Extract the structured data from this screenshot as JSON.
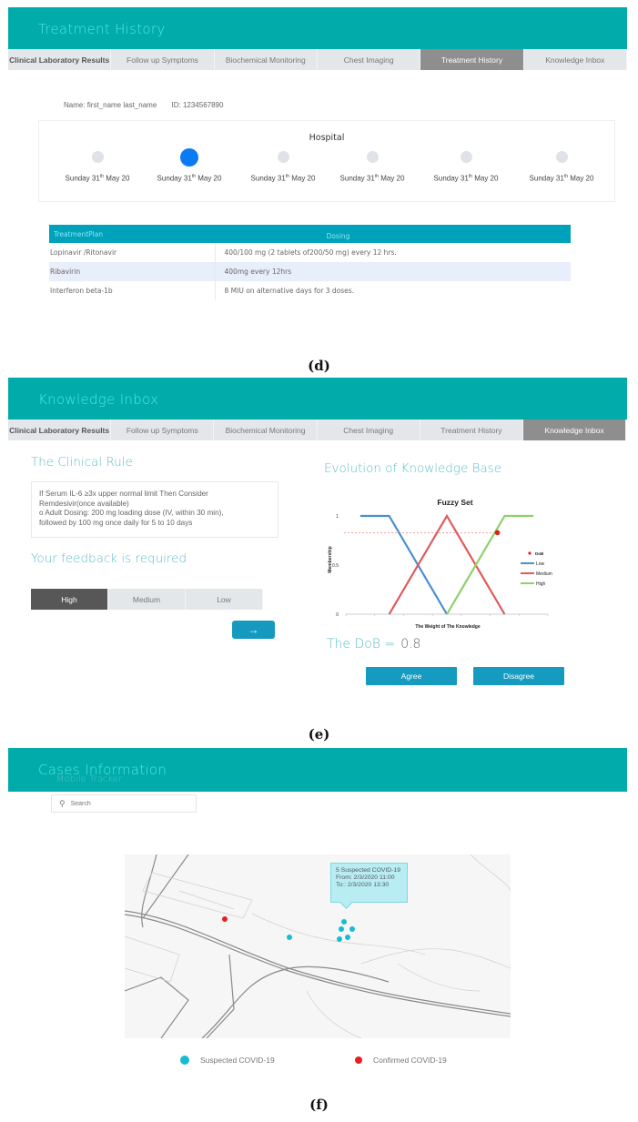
{
  "tabs": [
    "Clinical Laboratory Results",
    "Follow up Symptoms",
    "Biochemical Monitoring",
    "Chest Imaging",
    "Treatment History",
    "Knowledge Inbox"
  ],
  "panel_d": {
    "title": "Treatment History",
    "active_tab": 4,
    "patient": {
      "name": "Name: first_name last_name",
      "id": "ID: 1234567890"
    },
    "timeline": {
      "title": "Hospital",
      "selected_index": 1,
      "items": [
        {
          "day": "Sunday 31",
          "sup": "th",
          "rest": " May 20"
        },
        {
          "day": "Sunday 31",
          "sup": "th",
          "rest": " May 20"
        },
        {
          "day": "Sunday 31",
          "sup": "th",
          "rest": " May 20"
        },
        {
          "day": "Sunday 31",
          "sup": "th",
          "rest": " May 20"
        },
        {
          "day": "Sunday 31",
          "sup": "th",
          "rest": " May 20"
        },
        {
          "day": "Sunday 31",
          "sup": "th",
          "rest": " May 20"
        }
      ]
    },
    "table": {
      "headers": [
        "TreatmentPlan",
        "Dosing"
      ],
      "rows": [
        [
          "Lopinavir /Ritonavir",
          "400/100 mg (2 tablets of200/50 mg) every 12 hrs."
        ],
        [
          "Ribavirin",
          "400mg every 12hrs"
        ],
        [
          "Interferon beta-1b",
          "8 MIU on alternative days for 3 doses."
        ]
      ]
    },
    "caption": "(d)"
  },
  "panel_e": {
    "title": "Knowledge Inbox",
    "active_tab": 5,
    "rule_heading": "The Clinical Rule",
    "rule_lines": [
      "If Serum IL-6 ≥3x upper normal limit Then Consider",
      "Remdesivir(once available)",
      "o Adult Dosing: 200 mg loading dose (IV, within 30 min),",
      "followed by 100 mg once daily for 5 to 10 days"
    ],
    "feedback_heading": "Your feedback is required",
    "feedback_options": [
      "High",
      "Medium",
      "Low"
    ],
    "feedback_selected": 0,
    "next_icon": "→",
    "evolution_heading": "Evolution of Knowledge Base",
    "dob_label": "The DoB =",
    "dob_value": "0.8",
    "agree_label": "Agree",
    "disagree_label": "Disagree",
    "caption": "(e)"
  },
  "chart_data": {
    "type": "line",
    "title": "Fuzzy Set",
    "xlabel": "The Weight of The Knowledge",
    "ylabel": "Membership",
    "xlim": [
      0,
      7
    ],
    "ylim": [
      0,
      1
    ],
    "yticks": [
      "0",
      "0.5",
      "1"
    ],
    "xtick_count": 8,
    "grid": false,
    "legend_position": "right",
    "series": [
      {
        "name": "Low",
        "color": "#4a8fd0",
        "points": [
          [
            0.5,
            1
          ],
          [
            1.5,
            1
          ],
          [
            3.5,
            0
          ]
        ]
      },
      {
        "name": "Medium",
        "color": "#e05a5a",
        "points": [
          [
            1.5,
            0
          ],
          [
            3.5,
            1
          ],
          [
            5.5,
            0
          ]
        ]
      },
      {
        "name": "High",
        "color": "#8fd06a",
        "points": [
          [
            3.5,
            0
          ],
          [
            5.5,
            1
          ],
          [
            6.5,
            1
          ]
        ]
      }
    ],
    "marker": {
      "name": "DoB",
      "color": "#e02020",
      "x": 5.25,
      "y": 0.83
    },
    "reference_line": {
      "y": 0.83,
      "color": "#f08080",
      "style": "dashed"
    }
  },
  "panel_f": {
    "title": "Cases Information",
    "subtitle": "Mobile Tracker",
    "search_placeholder": "Search",
    "tooltip": [
      "5 Suspected COVID-19",
      "From: 2/3/2020 11:00",
      "To:: 2/3/2020 13:30"
    ],
    "legend": [
      {
        "label": "Suspected COVID-19",
        "color": "#16bcd4"
      },
      {
        "label": "Confirmed COVID-19",
        "color": "#e8201c"
      }
    ],
    "caption": "(f)"
  }
}
